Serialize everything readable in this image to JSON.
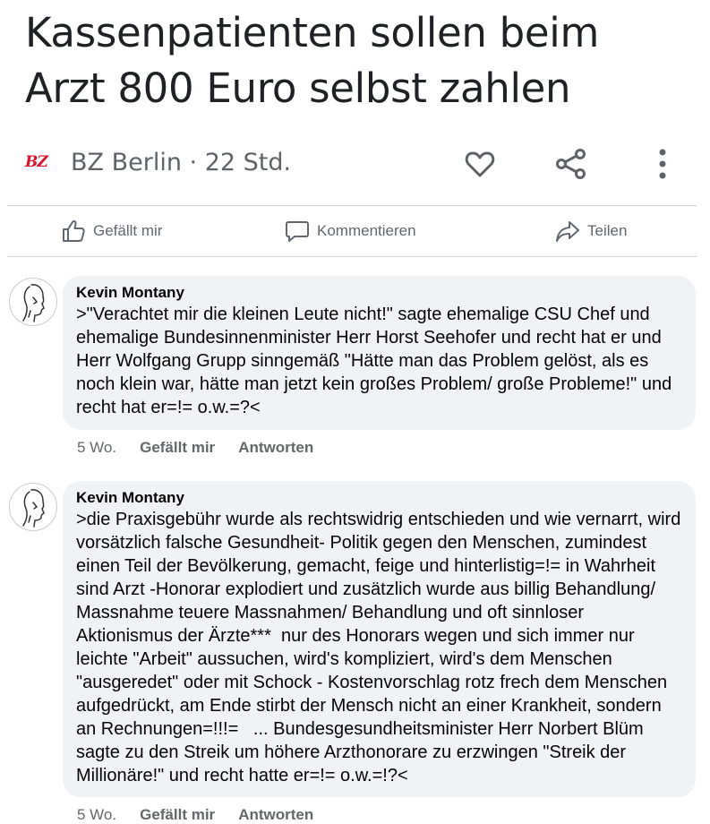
{
  "article": {
    "headline": "Kassenpatienten sollen beim Arzt 800 Euro selbst zahlen",
    "source_logo_text": "BZ",
    "source_meta": "BZ Berlin · 22 Std.",
    "icons": [
      "heart-icon",
      "share-icon",
      "more-vert-icon"
    ]
  },
  "action_bar": {
    "like_label": "Gefällt mir",
    "comment_label": "Kommentieren",
    "share_label": "Teilen"
  },
  "comments": [
    {
      "author": "Kevin Montany",
      "text": ">\"Verachtet mir die kleinen Leute nicht!\" sagte ehemalige CSU Chef und ehemalige Bundesinnenminister Herr Horst Seehofer und recht hat er und Herr Wolfgang Grupp sinngemäß \"Hätte man das Problem gelöst, als es noch klein war, hätte man jetzt kein großes Problem/ große Probleme!\" und recht hat er=!= o.w.=?<",
      "time": "5 Wo.",
      "like_label": "Gefällt mir",
      "reply_label": "Antworten"
    },
    {
      "author": "Kevin Montany",
      "text": ">die Praxisgebühr wurde als rechtswidrig entschieden und wie vernarrt, wird vorsätzlich falsche Gesundheit- Politik gegen den Menschen, zumindest einen Teil der Bevölkerung, gemacht, feige und hinterlistig=!= in Wahrheit sind Arzt -Honorar explodiert und zusätzlich wurde aus billig Behandlung/  Massnahme teuere Massnahmen/ Behandlung und oft sinnloser  Aktionismus der Ärzte***  nur des Honorars wegen und sich immer nur leichte \"Arbeit\" aussuchen, wird's kompliziert, wird's dem Menschen \"ausgeredet\" oder mit Schock - Kostenvorschlag rotz frech dem Menschen aufgedrückt, am Ende stirbt der Mensch nicht an einer Krankheit, sondern an Rechnungen=!!!=   ... Bundesgesundheitsminister Herr Norbert Blüm sagte zu den Streik um höhere Arzthonorare zu erzwingen \"Streik der Millionäre!\" und recht hatte er=!= o.w.=!?<",
      "time": "5 Wo.",
      "like_label": "Gefällt mir",
      "reply_label": "Antworten"
    }
  ]
}
